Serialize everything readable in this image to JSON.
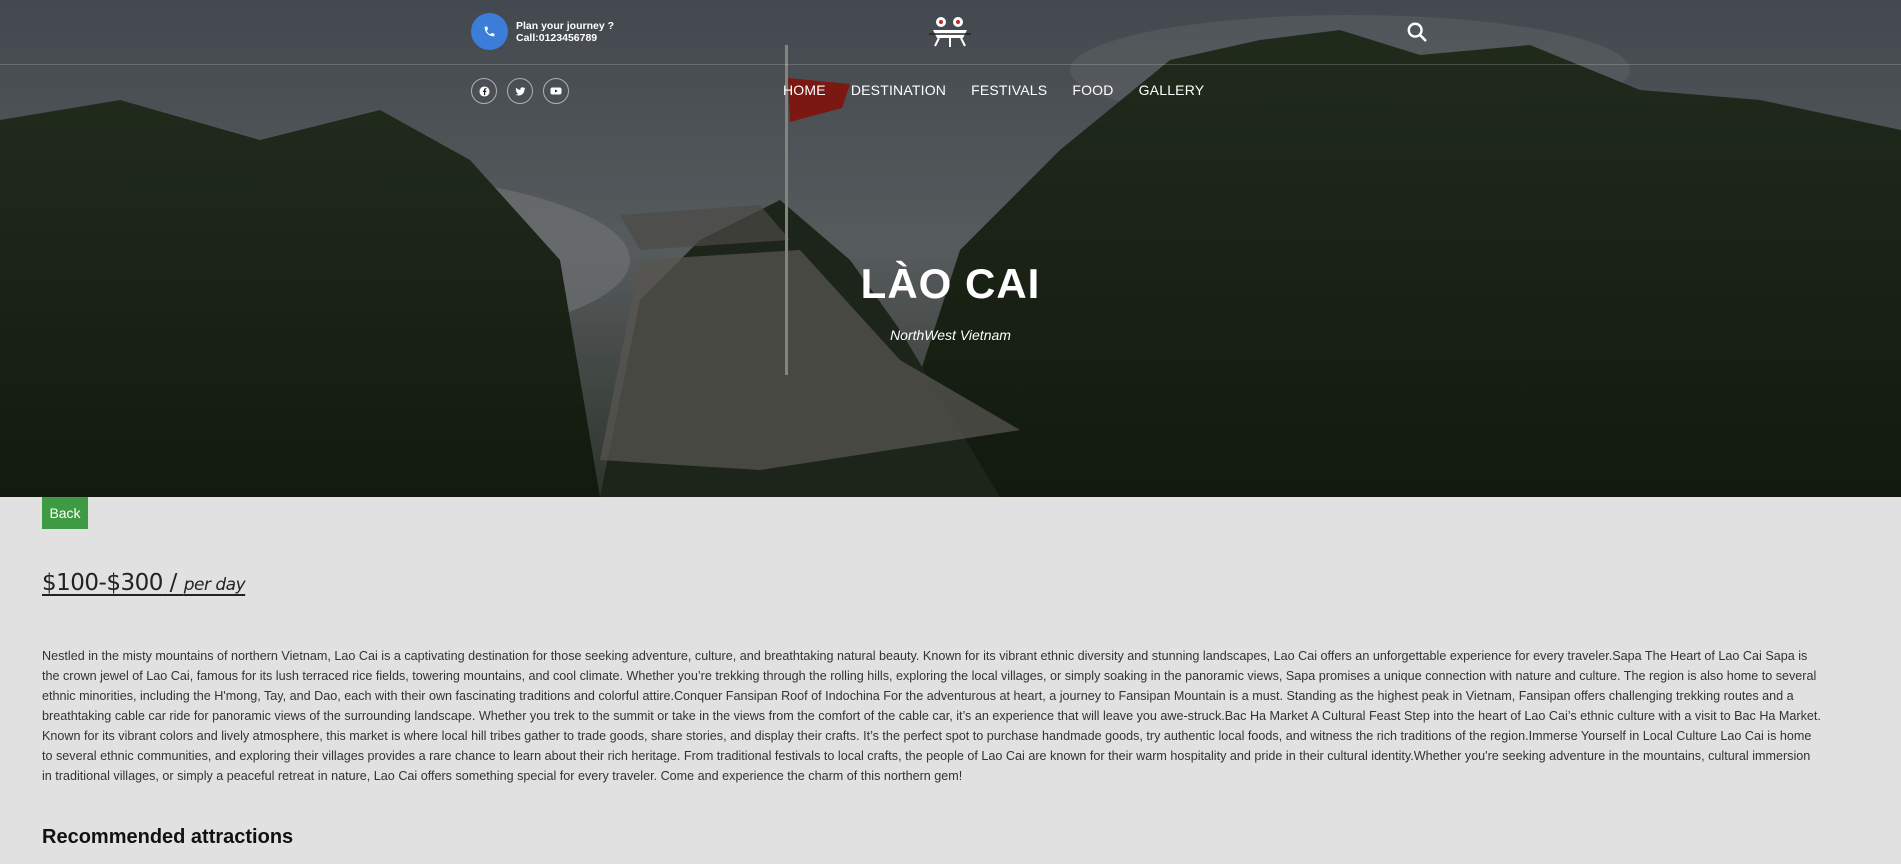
{
  "header": {
    "phone_line1": "Plan your journey ?",
    "phone_line2": "Call:0123456789"
  },
  "nav": {
    "items": [
      "HOME",
      "DESTINATION",
      "FESTIVALS",
      "FOOD",
      "GALLERY"
    ]
  },
  "social": [
    "facebook-icon",
    "twitter-icon",
    "youtube-icon"
  ],
  "hero": {
    "title": "LÀO CAI",
    "subtitle": "NorthWest Vietnam"
  },
  "content": {
    "back_label": "Back",
    "price_range": "$100-$300",
    "price_sep": " / ",
    "price_unit": "per day",
    "description": "Nestled in the misty mountains of northern Vietnam, Lao Cai is a captivating destination for those seeking adventure, culture, and breathtaking natural beauty. Known for its vibrant ethnic diversity and stunning landscapes, Lao Cai offers an unforgettable experience for every traveler.Sapa The Heart of Lao Cai Sapa is the crown jewel of Lao Cai, famous for its lush terraced rice fields, towering mountains, and cool climate. Whether you’re trekking through the rolling hills, exploring the local villages, or simply soaking in the panoramic views, Sapa promises a unique connection with nature and culture. The region is also home to several ethnic minorities, including the H'mong, Tay, and Dao, each with their own fascinating traditions and colorful attire.Conquer Fansipan Roof of Indochina For the adventurous at heart, a journey to Fansipan Mountain is a must. Standing as the highest peak in Vietnam, Fansipan offers challenging trekking routes and a breathtaking cable car ride for panoramic views of the surrounding landscape. Whether you trek to the summit or take in the views from the comfort of the cable car, it’s an experience that will leave you awe-struck.Bac Ha Market A Cultural Feast Step into the heart of Lao Cai’s ethnic culture with a visit to Bac Ha Market. Known for its vibrant colors and lively atmosphere, this market is where local hill tribes gather to trade goods, share stories, and display their crafts. It’s the perfect spot to purchase handmade goods, try authentic local foods, and witness the rich traditions of the region.Immerse Yourself in Local Culture Lao Cai is home to several ethnic communities, and exploring their villages provides a rare chance to learn about their rich heritage. From traditional festivals to local crafts, the people of Lao Cai are known for their warm hospitality and pride in their cultural identity.Whether you're seeking adventure in the mountains, cultural immersion in traditional villages, or simply a peaceful retreat in nature, Lao Cai offers something special for every traveler. Come and experience the charm of this northern gem!",
    "recommended_title": "Recommended attractions"
  },
  "colors": {
    "accent_blue": "#3b7dd8",
    "back_green": "#3e9b43",
    "page_bg": "#e1e1e1",
    "flag_red": "#c8281e"
  }
}
